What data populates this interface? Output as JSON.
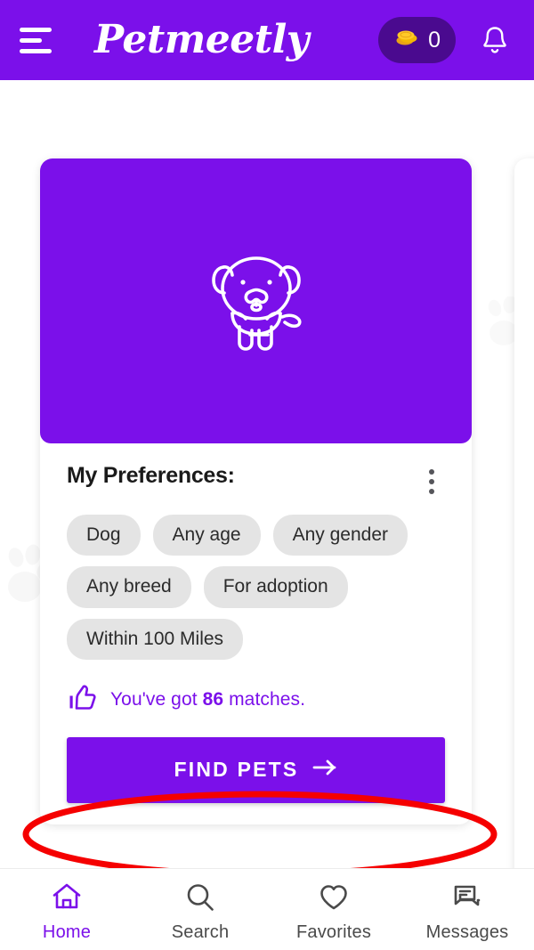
{
  "header": {
    "menu_icon": "hamburger-menu-icon",
    "logo_text": "Petmeetly",
    "coins_label": "0",
    "coin_icon": "coins-icon",
    "bell_icon": "notification-bell-icon"
  },
  "card": {
    "hero_icon": "dog-illustration",
    "prefs_title": "My Preferences:",
    "kebab_icon": "more-options-icon",
    "chips": [
      "Dog",
      "Any age",
      "Any gender",
      "Any breed",
      "For adoption",
      "Within 100 Miles"
    ],
    "matches_icon": "thumbs-up-icon",
    "matches_prefix": "You've got ",
    "matches_count": "86",
    "matches_suffix": " matches.",
    "find_button_label": "FIND PETS",
    "find_button_icon": "arrow-right-icon"
  },
  "carousel": {
    "dot_count": 4,
    "active_index": 2
  },
  "bottom_nav": {
    "items": [
      {
        "label": "Home",
        "icon": "home-icon",
        "active": true
      },
      {
        "label": "Search",
        "icon": "search-icon",
        "active": false
      },
      {
        "label": "Favorites",
        "icon": "heart-icon",
        "active": false
      },
      {
        "label": "Messages",
        "icon": "chat-bubbles-icon",
        "active": false
      }
    ]
  },
  "annotation": {
    "shape": "red-ellipse-highlight",
    "target": "find-pets-button",
    "color": "#F50000"
  },
  "colors": {
    "brand_purple": "#7B10EA",
    "dark_purple": "#4A0A8F",
    "coin_gold": "#F5C518",
    "chip_gray": "#E4E4E4",
    "annotation_red": "#F50000"
  }
}
